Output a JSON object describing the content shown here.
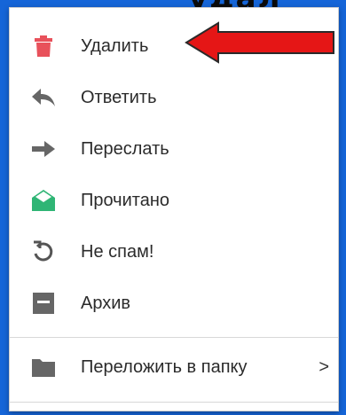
{
  "background_title": "удал",
  "colors": {
    "background": "#1565d8",
    "delete_icon": "#e8515b",
    "read_icon": "#2fb575",
    "gray_icon": "#666666",
    "arrow": "#e51616"
  },
  "menu": {
    "items": [
      {
        "label": "Удалить",
        "icon": "trash-icon"
      },
      {
        "label": "Ответить",
        "icon": "reply-icon"
      },
      {
        "label": "Переслать",
        "icon": "forward-icon"
      },
      {
        "label": "Прочитано",
        "icon": "open-envelope-icon"
      },
      {
        "label": "Не спам!",
        "icon": "undo-icon"
      },
      {
        "label": "Архив",
        "icon": "archive-icon"
      }
    ],
    "submenu_item": {
      "label": "Переложить в папку",
      "icon": "folder-icon",
      "chevron": ">"
    }
  }
}
